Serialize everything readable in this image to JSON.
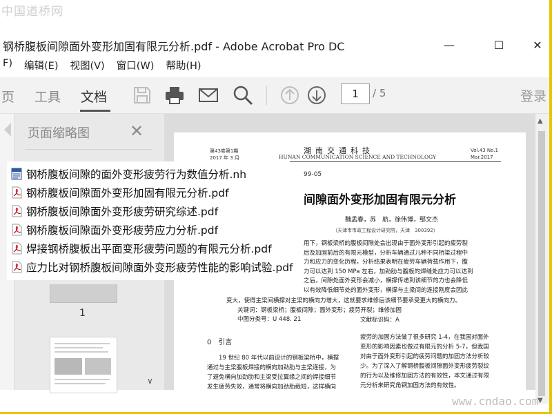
{
  "watermark": {
    "top": "中国道桥网",
    "bottom": "www.cndao.com"
  },
  "window": {
    "title": "钢桥腹板间隙面外变形加固有限元分析.pdf - Adobe Acrobat Pro DC",
    "minimize": "—",
    "maximize": "☐",
    "close": "✕"
  },
  "menu": [
    "F)",
    "编辑(E)",
    "视图(V)",
    "窗口(W)",
    "帮助(H)"
  ],
  "toolbar": {
    "tabs": [
      "页",
      "工具",
      "文档"
    ],
    "page_current": "1",
    "page_total": "/ 5",
    "login": "登录"
  },
  "sidepanel": {
    "title": "页面缩略图",
    "close": "✕",
    "thumb_label": "1",
    "scroll_arrow": "∨"
  },
  "pdf": {
    "issue_left": [
      "第43卷第1期",
      "2017 年 3 月"
    ],
    "journal_cn": "湖南交通科技",
    "journal_en": "HUNAN COMMUNICATION SCIENCE AND TECHNOLOGY",
    "issue_right": [
      "Vol.43 No.1",
      "Mar.2017"
    ],
    "doc_code": "99-05",
    "title": "间隙面外变形加固有限元分析",
    "authors": "魏孟春，苏　航，徐伟博，鄢文杰",
    "affiliation": "（天津市市政工程设计研究院，天津　300392）",
    "abstract_lines": [
      "用下，钢板梁桥的腹板间隙处会出现由于面外变形引起的疲劳裂",
      "后及加固前后的有限元模型，分析车辆通过儿种不同桥梁过程中",
      "力和应力的变化历程。分析结果表明在疲劳车辆荷载作用下，腹",
      "力可以达到 150 MPa 左右，加劲肋与腹板的焊缝处应力可以达到",
      "之后，间隙处面外变形会减小，横撑传递到该细节的力也会降低",
      "以有效降低细节处的面外变形，横撑与主梁间的连接刚度会因此"
    ],
    "abstract_last": "变大，使得主梁间横撑对主梁的横向力增大，这就要求维修后该细节要承受更大的横向力。",
    "keywords": "关键词：钢板梁桥；腹板间隙；面外变形；疲劳开裂；维修加固",
    "clc": "中图分类号：U 448. 21",
    "doc_id": "文献标识码：A",
    "section_head": "0　引言",
    "col_left": [
      "　　19 世纪 80 年代以前设计的钢板梁桥中，横撑",
      "通过与主梁腹板焊接的横向加劲肋与主梁连接，为",
      "了避免横向加劲肋和主梁受拉翼缘之间的焊接细节",
      "发生疲劳失效，通常将横向加劲肋截短，这样横向"
    ],
    "col_right": [
      "疲劳的加固方法做了很多研究 1-4，在我国对面外",
      "变形的影响因素也做过有限元的分析 5-7，但我国",
      "对由于面外变形引起的疲劳问题的加固方法分析较",
      "少。为了深入了解钢桥腹板间隙面外变形疲劳裂纹",
      "的行为以及维修加固方法的有效性，本文通过有限",
      "元分析来研究角钢加固方法的有效性。"
    ]
  },
  "files": [
    {
      "name": "钢桥腹板间隙的面外变形疲劳行为数值分析.nh",
      "icon": "nh-file-icon"
    },
    {
      "name": "钢桥腹板间隙面外变形加固有限元分析.pdf",
      "icon": "pdf-file-icon"
    },
    {
      "name": "钢桥腹板间隙面外变形疲劳研究综述.pdf",
      "icon": "pdf-file-icon"
    },
    {
      "name": "钢桥腹板间隙面外变形疲劳应力分析.pdf",
      "icon": "pdf-file-icon"
    },
    {
      "name": "焊接钢桥腹板出平面变形疲劳问题的有限元分析.pdf",
      "icon": "pdf-file-icon"
    },
    {
      "name": "应力比对钢桥腹板间隙面外变形疲劳性能的影响试验.pdf",
      "icon": "pdf-file-icon"
    }
  ]
}
